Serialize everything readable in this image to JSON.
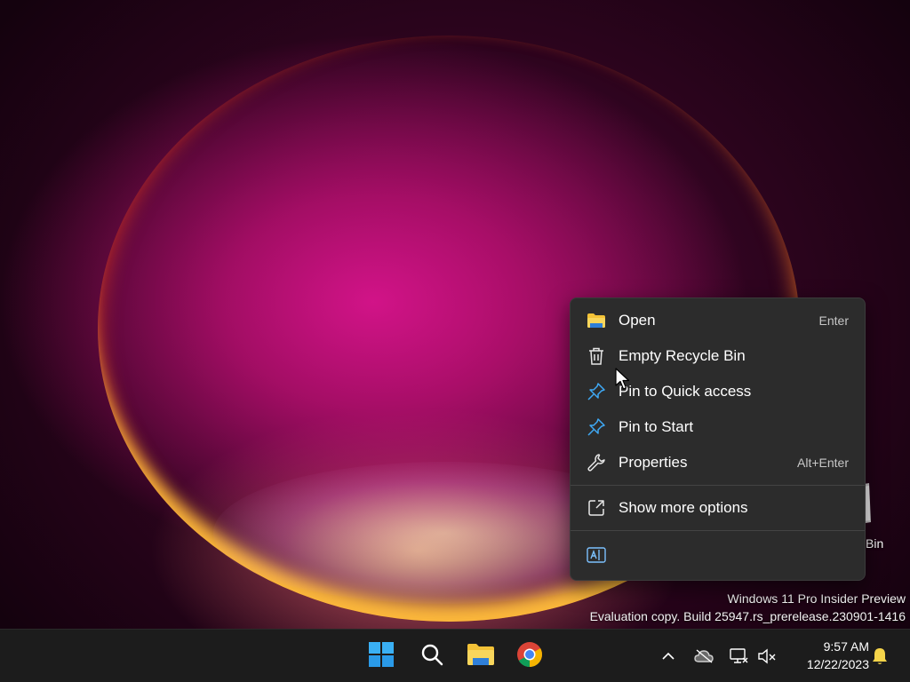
{
  "desktop": {
    "recycle_bin_label": "Bin"
  },
  "watermark": {
    "line1": "Windows 11 Pro Insider Preview",
    "line2": "Evaluation copy. Build 25947.rs_prerelease.230901-1416"
  },
  "context_menu": {
    "items": [
      {
        "label": "Open",
        "shortcut": "Enter",
        "icon": "folder-icon"
      },
      {
        "label": "Empty Recycle Bin",
        "shortcut": "",
        "icon": "trash-icon"
      },
      {
        "label": "Pin to Quick access",
        "shortcut": "",
        "icon": "pin-icon"
      },
      {
        "label": "Pin to Start",
        "shortcut": "",
        "icon": "pin-icon"
      },
      {
        "label": "Properties",
        "shortcut": "Alt+Enter",
        "icon": "wrench-icon"
      }
    ],
    "more_options": {
      "label": "Show more options",
      "icon": "share-external-icon"
    },
    "bottom_action": {
      "icon": "translate-icon"
    }
  },
  "taskbar": {
    "apps": [
      {
        "name": "Start",
        "icon": "windows-logo-icon"
      },
      {
        "name": "Search",
        "icon": "search-icon"
      },
      {
        "name": "File Explorer",
        "icon": "folder-icon"
      },
      {
        "name": "Google Chrome",
        "icon": "chrome-icon"
      }
    ],
    "tray": {
      "icons": [
        "chevron-up-icon",
        "onedrive-offline-icon",
        "network-icon",
        "volume-muted-icon"
      ],
      "time": "9:57 AM",
      "date": "12/22/2023",
      "notification_icon": "bell-icon"
    }
  },
  "colors": {
    "menu_bg": "#2c2c2c",
    "taskbar_bg": "#1c1c1c",
    "accent_blue": "#3fa9f5",
    "folder_yellow": "#f3c237"
  }
}
